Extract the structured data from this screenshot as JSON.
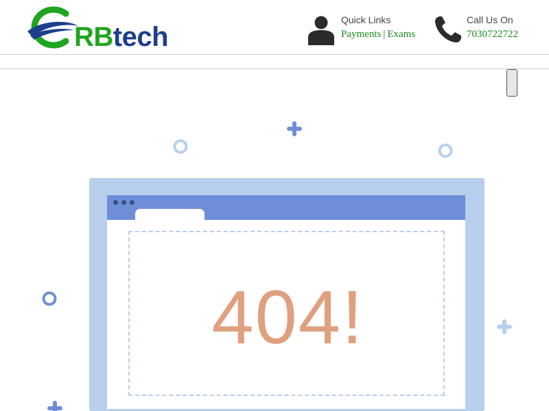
{
  "brand": {
    "logo_text_1": "RB",
    "logo_text_2": "tech"
  },
  "header": {
    "quick_links": {
      "label": "Quick Links",
      "links": [
        "Payments",
        "Exams"
      ],
      "separator": "|"
    },
    "call": {
      "label": "Call Us On",
      "phone": "7030722722"
    }
  },
  "error": {
    "code_text": "404!"
  },
  "colors": {
    "brand_green": "#1fa51f",
    "brand_blue": "#1c3f8a",
    "link_green": "#1a8a1a",
    "frame": "#b7cfec",
    "titlebar": "#6f8ed8",
    "error_text": "#e0a080"
  },
  "icons": [
    "user-icon",
    "phone-icon",
    "plus-icon",
    "circle-outline-icon"
  ]
}
